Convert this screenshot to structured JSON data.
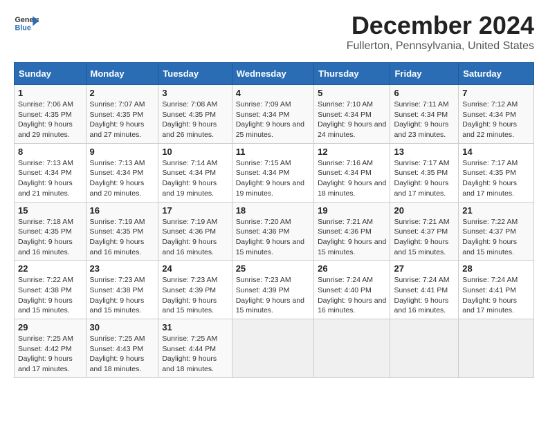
{
  "header": {
    "logo_line1": "General",
    "logo_line2": "Blue",
    "title": "December 2024",
    "subtitle": "Fullerton, Pennsylvania, United States"
  },
  "columns": [
    "Sunday",
    "Monday",
    "Tuesday",
    "Wednesday",
    "Thursday",
    "Friday",
    "Saturday"
  ],
  "weeks": [
    [
      {
        "day": "1",
        "sunrise": "7:06 AM",
        "sunset": "4:35 PM",
        "daylight": "9 hours and 29 minutes."
      },
      {
        "day": "2",
        "sunrise": "7:07 AM",
        "sunset": "4:35 PM",
        "daylight": "9 hours and 27 minutes."
      },
      {
        "day": "3",
        "sunrise": "7:08 AM",
        "sunset": "4:35 PM",
        "daylight": "9 hours and 26 minutes."
      },
      {
        "day": "4",
        "sunrise": "7:09 AM",
        "sunset": "4:34 PM",
        "daylight": "9 hours and 25 minutes."
      },
      {
        "day": "5",
        "sunrise": "7:10 AM",
        "sunset": "4:34 PM",
        "daylight": "9 hours and 24 minutes."
      },
      {
        "day": "6",
        "sunrise": "7:11 AM",
        "sunset": "4:34 PM",
        "daylight": "9 hours and 23 minutes."
      },
      {
        "day": "7",
        "sunrise": "7:12 AM",
        "sunset": "4:34 PM",
        "daylight": "9 hours and 22 minutes."
      }
    ],
    [
      {
        "day": "8",
        "sunrise": "7:13 AM",
        "sunset": "4:34 PM",
        "daylight": "9 hours and 21 minutes."
      },
      {
        "day": "9",
        "sunrise": "7:13 AM",
        "sunset": "4:34 PM",
        "daylight": "9 hours and 20 minutes."
      },
      {
        "day": "10",
        "sunrise": "7:14 AM",
        "sunset": "4:34 PM",
        "daylight": "9 hours and 19 minutes."
      },
      {
        "day": "11",
        "sunrise": "7:15 AM",
        "sunset": "4:34 PM",
        "daylight": "9 hours and 19 minutes."
      },
      {
        "day": "12",
        "sunrise": "7:16 AM",
        "sunset": "4:34 PM",
        "daylight": "9 hours and 18 minutes."
      },
      {
        "day": "13",
        "sunrise": "7:17 AM",
        "sunset": "4:35 PM",
        "daylight": "9 hours and 17 minutes."
      },
      {
        "day": "14",
        "sunrise": "7:17 AM",
        "sunset": "4:35 PM",
        "daylight": "9 hours and 17 minutes."
      }
    ],
    [
      {
        "day": "15",
        "sunrise": "7:18 AM",
        "sunset": "4:35 PM",
        "daylight": "9 hours and 16 minutes."
      },
      {
        "day": "16",
        "sunrise": "7:19 AM",
        "sunset": "4:35 PM",
        "daylight": "9 hours and 16 minutes."
      },
      {
        "day": "17",
        "sunrise": "7:19 AM",
        "sunset": "4:36 PM",
        "daylight": "9 hours and 16 minutes."
      },
      {
        "day": "18",
        "sunrise": "7:20 AM",
        "sunset": "4:36 PM",
        "daylight": "9 hours and 15 minutes."
      },
      {
        "day": "19",
        "sunrise": "7:21 AM",
        "sunset": "4:36 PM",
        "daylight": "9 hours and 15 minutes."
      },
      {
        "day": "20",
        "sunrise": "7:21 AM",
        "sunset": "4:37 PM",
        "daylight": "9 hours and 15 minutes."
      },
      {
        "day": "21",
        "sunrise": "7:22 AM",
        "sunset": "4:37 PM",
        "daylight": "9 hours and 15 minutes."
      }
    ],
    [
      {
        "day": "22",
        "sunrise": "7:22 AM",
        "sunset": "4:38 PM",
        "daylight": "9 hours and 15 minutes."
      },
      {
        "day": "23",
        "sunrise": "7:23 AM",
        "sunset": "4:38 PM",
        "daylight": "9 hours and 15 minutes."
      },
      {
        "day": "24",
        "sunrise": "7:23 AM",
        "sunset": "4:39 PM",
        "daylight": "9 hours and 15 minutes."
      },
      {
        "day": "25",
        "sunrise": "7:23 AM",
        "sunset": "4:39 PM",
        "daylight": "9 hours and 15 minutes."
      },
      {
        "day": "26",
        "sunrise": "7:24 AM",
        "sunset": "4:40 PM",
        "daylight": "9 hours and 16 minutes."
      },
      {
        "day": "27",
        "sunrise": "7:24 AM",
        "sunset": "4:41 PM",
        "daylight": "9 hours and 16 minutes."
      },
      {
        "day": "28",
        "sunrise": "7:24 AM",
        "sunset": "4:41 PM",
        "daylight": "9 hours and 17 minutes."
      }
    ],
    [
      {
        "day": "29",
        "sunrise": "7:25 AM",
        "sunset": "4:42 PM",
        "daylight": "9 hours and 17 minutes."
      },
      {
        "day": "30",
        "sunrise": "7:25 AM",
        "sunset": "4:43 PM",
        "daylight": "9 hours and 18 minutes."
      },
      {
        "day": "31",
        "sunrise": "7:25 AM",
        "sunset": "4:44 PM",
        "daylight": "9 hours and 18 minutes."
      },
      null,
      null,
      null,
      null
    ]
  ],
  "labels": {
    "sunrise": "Sunrise:",
    "sunset": "Sunset:",
    "daylight": "Daylight:"
  },
  "accent_color": "#2a6db5"
}
